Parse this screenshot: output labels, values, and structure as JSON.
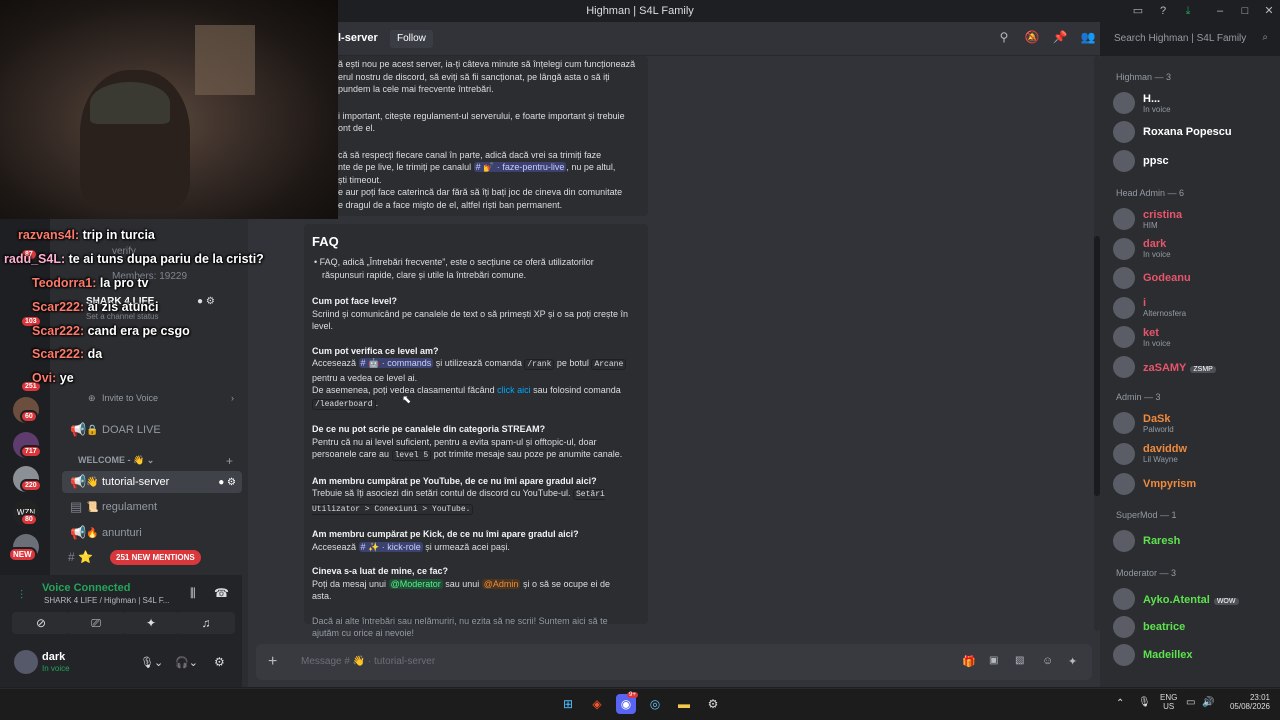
{
  "window": {
    "title": "Highman | S4L Family"
  },
  "header": {
    "channel": "l-server",
    "follow_label": "Follow",
    "search_placeholder": "Search Highman | S4L Family"
  },
  "intro_lines": [
    "ă ești nou pe acest server, ia-ți câteva minute să înțelegi cum funcționează",
    "erul nostru de discord, să eviți să fii sancționat, pe lângă asta o să iți",
    "pundem la cele mai frecvente întrebări.",
    "i important, citește regulament-ul serverului, e foarte important și trebuie",
    "ont de el.",
    "că să respecți fiecare canal în parte, adică dacă vrei sa trimiți faze",
    "nte de pe live, le trimiți pe canalul",
    "ști timeout.",
    "e aur poți face caterincă dar fără să îți bați joc de cineva din comunitate",
    "e dragul de a face mişto de el, altfel riști ban permanent."
  ],
  "intro_channel": "faze-pentru-live",
  "intro_channel_tail": ", nu pe altul,",
  "faq": {
    "title": "FAQ",
    "bullet": "FAQ, adică „Întrebări frecvente”, este o secțiune ce oferă utilizatorilor răspunsuri rapide, clare și utile la întrebări comune.",
    "q1": "Cum pot face level?",
    "a1": "Scriind și comunicând pe canalele de text o să primești XP și o sa poți crește în level.",
    "q2": "Cum pot verifica ce level am?",
    "a2_pre": "Accesează",
    "a2_channel": "commands",
    "a2_mid": "și utilizează comanda",
    "a2_cmd": "/rank",
    "a2_post": "pe botul",
    "a2_bot": "Arcane",
    "a2_line2": "pentru a vedea ce level ai.",
    "a2_line3_pre": "De asemenea, poți vedea clasamentul făcând",
    "a2_link": "click aici",
    "a2_line3_post": "sau folosind comanda",
    "a2_cmd2": "/leaderboard",
    "q3": "De ce nu pot scrie pe canalele din categoria STREAM?",
    "a3_pre": "Pentru că nu ai level suficient, pentru a evita spam-ul și offtopic-ul, doar persoanele care au",
    "a3_code": "level 5",
    "a3_post": "pot trimite mesaje sau poze pe anumite canale.",
    "q4": "Am membru cumpărat pe YouTube, de ce nu îmi apare gradul aici?",
    "a4_pre": "Trebuie să îți asociezi din setări contul de discord cu YouTube-ul.",
    "a4_code": "Setări Utilizator > Conexiuni > YouTube.",
    "q5": "Am membru cumpărat pe Kick, de ce nu îmi apare gradul aici?",
    "a5_pre": "Accesează",
    "a5_channel": "kick-role",
    "a5_post": "și urmează acei pași.",
    "q6": "Cineva s-a luat de mine, ce fac?",
    "a6_pre": "Poți da mesaj unui",
    "a6_mod": "@Moderator",
    "a6_mid": "sau unui",
    "a6_admin": "@Admin",
    "a6_post": "și o să se ocupe ei de asta.",
    "footer": "Dacă ai alte întrebări sau nelămuriri, nu ezita să ne scrii! Suntem aici să te ajutăm cu orice ai nevoie!"
  },
  "stream_chat": [
    {
      "user": "razvans4l:",
      "text": "trip in turcia"
    },
    {
      "user": "radu_S4L:",
      "text": "te ai tuns dupa pariu de la cristi?"
    },
    {
      "user": "Teodorra1:",
      "text": "la pro tv"
    },
    {
      "user": "Scar222:",
      "text": "ai zis atunci"
    },
    {
      "user": "Scar222:",
      "text": "cand era pe csgo"
    },
    {
      "user": "Scar222:",
      "text": "da"
    },
    {
      "user": "Ovi:",
      "text": "ye"
    }
  ],
  "sidebar": {
    "server_name": "SHARK 4 LIFE",
    "status_hint": "Set a channel status",
    "members_count": "Members: 19229",
    "verify": "verify",
    "invite": "Invite to Voice",
    "doar_live": "DOAR LIVE",
    "category": "WELCOME - 👋",
    "channels": [
      "tutorial-server",
      "regulament",
      "anunturi"
    ],
    "mentions": "251 NEW MENTIONS",
    "voice_status": "Voice Connected",
    "voice_channel": "SHARK 4 LIFE / Highman | S4L F...",
    "user_name": "dark",
    "user_status": "In voice",
    "new_badge": "NEW"
  },
  "guild_badges": [
    "87",
    "103",
    "251",
    "60",
    "717",
    "220",
    "80",
    "80"
  ],
  "members": {
    "groups": [
      {
        "name": "Highman — 3",
        "items": [
          {
            "name": "H...",
            "sub": "In voice",
            "color": "#ffffff"
          },
          {
            "name": "Roxana Popescu",
            "sub": "",
            "color": "#ffffff"
          },
          {
            "name": "ppsc",
            "sub": "",
            "color": "#ffffff"
          }
        ]
      },
      {
        "name": "Head Admin — 6",
        "items": [
          {
            "name": "cristina",
            "sub": "HIM",
            "color": "#e8556b"
          },
          {
            "name": "dark",
            "sub": "In voice",
            "color": "#e8556b"
          },
          {
            "name": "Godeanu",
            "sub": "",
            "color": "#e8556b"
          },
          {
            "name": "i",
            "sub": "Alternosfera",
            "color": "#e8556b"
          },
          {
            "name": "ket",
            "sub": "In voice",
            "color": "#e8556b"
          },
          {
            "name": "zaSAMY",
            "sub": "",
            "color": "#e8556b",
            "tag": "ZSMP"
          }
        ]
      },
      {
        "name": "Admin — 3",
        "items": [
          {
            "name": "DaSk",
            "sub": "Palworld",
            "color": "#f08a3c"
          },
          {
            "name": "daviddw",
            "sub": "Lil Wayne",
            "color": "#f08a3c"
          },
          {
            "name": "Vmpyrism",
            "sub": "",
            "color": "#f08a3c"
          }
        ]
      },
      {
        "name": "SuperMod — 1",
        "items": [
          {
            "name": "Raresh",
            "sub": "",
            "color": "#5ee34e"
          }
        ]
      },
      {
        "name": "Moderator — 3",
        "items": [
          {
            "name": "Ayko.Atental",
            "sub": "",
            "color": "#5ee34e",
            "tag": "WOW"
          },
          {
            "name": "beatrice",
            "sub": "",
            "color": "#5ee34e"
          },
          {
            "name": "Madeillex",
            "sub": "",
            "color": "#5ee34e"
          }
        ]
      }
    ]
  },
  "input": {
    "placeholder": "Message # 👋 · tutorial-server"
  },
  "taskbar": {
    "lang": "ENG",
    "region": "US",
    "time": "23:01",
    "date": "05/08/2026",
    "discord_badge": "9+"
  }
}
